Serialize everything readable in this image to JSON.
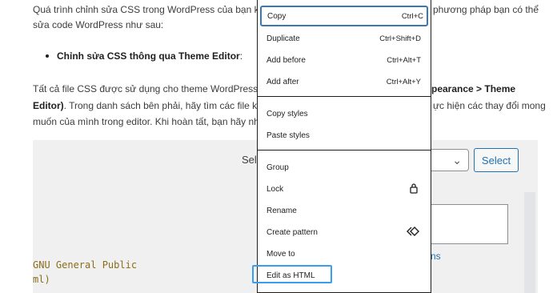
{
  "article": {
    "line1_left": "Quá trình chỉnh sửa CSS trong WordPress của bạn khá g",
    "line1_right": "phương pháp bạn có thể",
    "line2": "sửa code WordPress như sau:",
    "bullet": "Chỉnh sửa CSS thông qua Theme Editor",
    "bullet_suffix": ":",
    "para_line1_left": "Tất cả file CSS được sử dụng cho theme WordPress có t",
    "para_line1_right": "pearance > Theme",
    "para_line2_bold": "Editor)",
    "para_line2_left": ". Trong danh sách bên phải, hãy tìm các file kết t",
    "para_line2_right": "ực hiện các thay đổi mong",
    "para_line3_left": "muốn của mình trong editor. Khi hoàn tất, bạn hãy nhấp"
  },
  "editor": {
    "label_fragment": "Sel",
    "select_chevron": "⌄",
    "select_button": "Select",
    "link_fragment": "ns",
    "code_lines": [
      "GNU General Public",
      "ml)"
    ]
  },
  "context_menu": {
    "items": [
      {
        "label": "Copy",
        "shortcut": "Ctrl+C"
      },
      {
        "label": "Duplicate",
        "shortcut": "Ctrl+Shift+D"
      },
      {
        "label": "Add before",
        "shortcut": "Ctrl+Alt+T"
      },
      {
        "label": "Add after",
        "shortcut": "Ctrl+Alt+Y"
      },
      {
        "label": "Copy styles",
        "shortcut": ""
      },
      {
        "label": "Paste styles",
        "shortcut": ""
      },
      {
        "label": "Group",
        "shortcut": ""
      },
      {
        "label": "Lock",
        "icon": "lock-icon"
      },
      {
        "label": "Rename",
        "shortcut": ""
      },
      {
        "label": "Create pattern",
        "icon": "diamond-arrows-icon"
      },
      {
        "label": "Move to",
        "shortcut": ""
      },
      {
        "label": "Edit as HTML",
        "shortcut": ""
      }
    ]
  },
  "colors": {
    "accent": "#3a9ef0",
    "focus_border": "#3878b8",
    "wp_blue": "#2271b1",
    "editor_bg": "#f0f0f1"
  }
}
